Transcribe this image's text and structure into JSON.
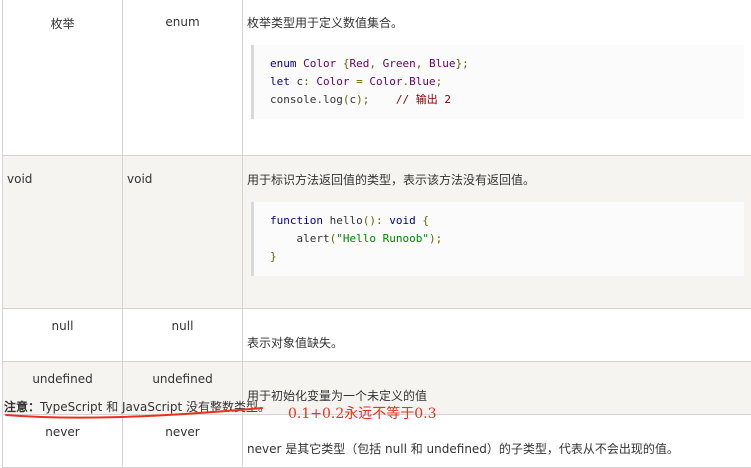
{
  "rows": [
    {
      "name": "枚举",
      "keyword": "enum",
      "description": "枚举类型用于定义数值集合。",
      "code": [
        "enum Color {Red, Green, Blue};",
        "let c: Color = Color.Blue;",
        "console.log(c);    // 输出 2"
      ]
    },
    {
      "name": "void",
      "keyword": "void",
      "description": "用于标识方法返回值的类型，表示该方法没有返回值。",
      "code": [
        "function hello(): void {",
        "    alert(\"Hello Runoob\");",
        "}"
      ]
    },
    {
      "name": "null",
      "keyword": "null",
      "description": "表示对象值缺失。"
    },
    {
      "name": "undefined",
      "keyword": "undefined",
      "description": "用于初始化变量为一个未定义的值"
    },
    {
      "name": "never",
      "keyword": "never",
      "description": "never 是其它类型（包括 null 和 undefined）的子类型，代表从不会出现的值。"
    }
  ],
  "note": {
    "label": "注意：",
    "text": "TypeScript 和 JavaScript 没有整数类型。"
  },
  "annotation": {
    "text": "0.1+0.2永远不等于0.3",
    "color": "#e8321e"
  },
  "colors": {
    "border": "#d4d4d4",
    "shade": "#f6f4f0",
    "annotation_red": "#e8321e"
  }
}
